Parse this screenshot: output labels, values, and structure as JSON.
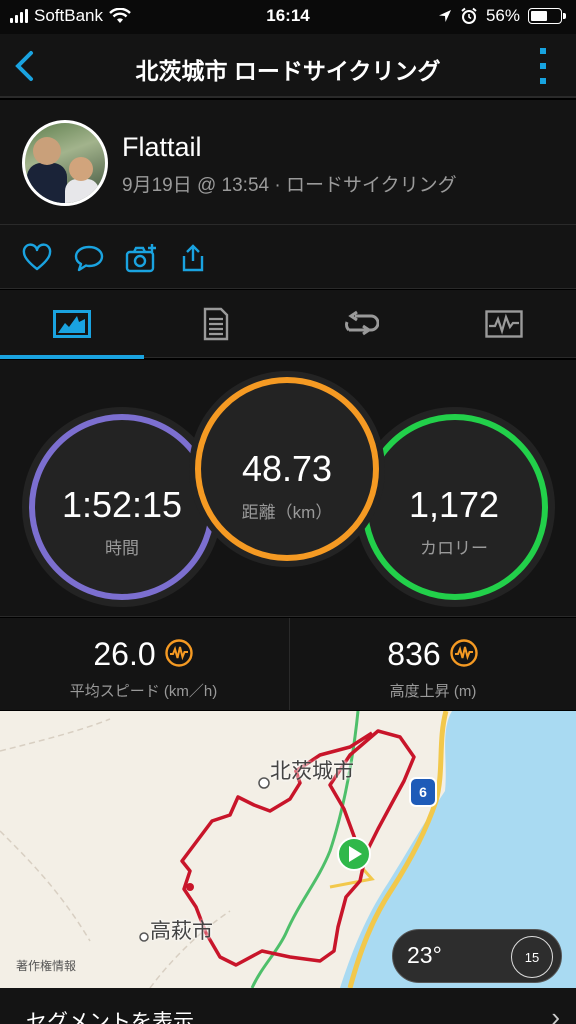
{
  "status": {
    "carrier": "SoftBank",
    "time": "16:14",
    "battery": "56%",
    "battery_level": 0.56
  },
  "header": {
    "title": "北茨城市 ロードサイクリング"
  },
  "profile": {
    "name": "Flattail",
    "meta": "9月19日 @ 13:54 · ロードサイクリング"
  },
  "stats": {
    "time": {
      "value": "1:52:15",
      "label": "時間"
    },
    "distance": {
      "value": "48.73",
      "label": "距離（km）"
    },
    "calories": {
      "value": "1,172",
      "label": "カロリー"
    },
    "avg_speed": {
      "value": "26.0",
      "label": "平均スピード (km／h)"
    },
    "elevation": {
      "value": "836",
      "label": "高度上昇 (m)"
    }
  },
  "colors": {
    "accent": "#1aa3e0",
    "time_ring": "#7c6fd0",
    "distance_ring": "#f59a23",
    "calories_ring": "#22d04a",
    "route": "#c8152a"
  },
  "map": {
    "city_1": "北茨城市",
    "city_2": "高萩市",
    "route_badge": "6",
    "credit": "著作権情報",
    "temperature": "23°",
    "wind": "15"
  },
  "footer": {
    "label": "セグメントを表示"
  },
  "icons": {
    "back": "chevron-left-icon",
    "more": "more-vertical-icon",
    "like": "heart-icon",
    "comment": "comment-icon",
    "photo": "camera-add-icon",
    "share": "share-icon"
  }
}
